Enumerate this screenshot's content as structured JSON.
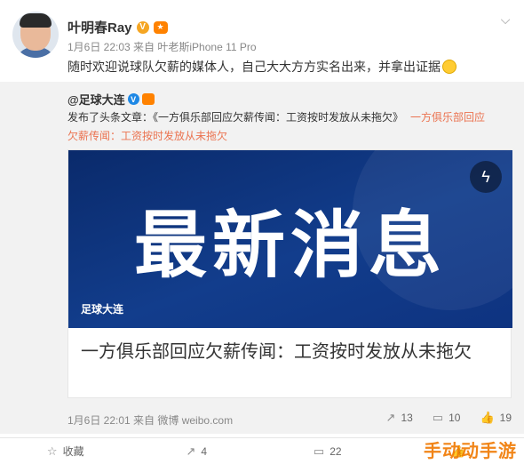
{
  "post": {
    "username": "叶明春Ray",
    "v_badge": "V",
    "meta": "1月6日 22:03 来自 叶老斯iPhone 11 Pro",
    "text": "随时欢迎说球队欠薪的媒体人，自己大大方方实名出来，并拿出证据"
  },
  "repost": {
    "author": "@足球大连",
    "v_badge": "V",
    "line1_prefix": "发布了头条文章：《一方俱乐部回应欠薪传闻：工资按时发放从未拖欠》",
    "line1_link": "一方俱乐部回应",
    "line2_link": "欠薪传闻：工资按时发放从未拖欠",
    "card": {
      "banner_text": "最新消息",
      "banner_brand": "足球大连",
      "title": "一方俱乐部回应欠薪传闻：工资按时发放从未拖欠"
    },
    "footer_meta": "1月6日 22:01 来自 微博 weibo.com",
    "stats": {
      "reposts": "13",
      "comments": "10",
      "likes": "19"
    }
  },
  "actions": {
    "favorite": "收藏",
    "repost": "4",
    "comment": "22"
  },
  "watermark": "手动动手游",
  "icons": [
    "chevron-down-icon",
    "flash-icon",
    "repost-icon",
    "comment-icon",
    "like-icon",
    "favorite-icon"
  ]
}
